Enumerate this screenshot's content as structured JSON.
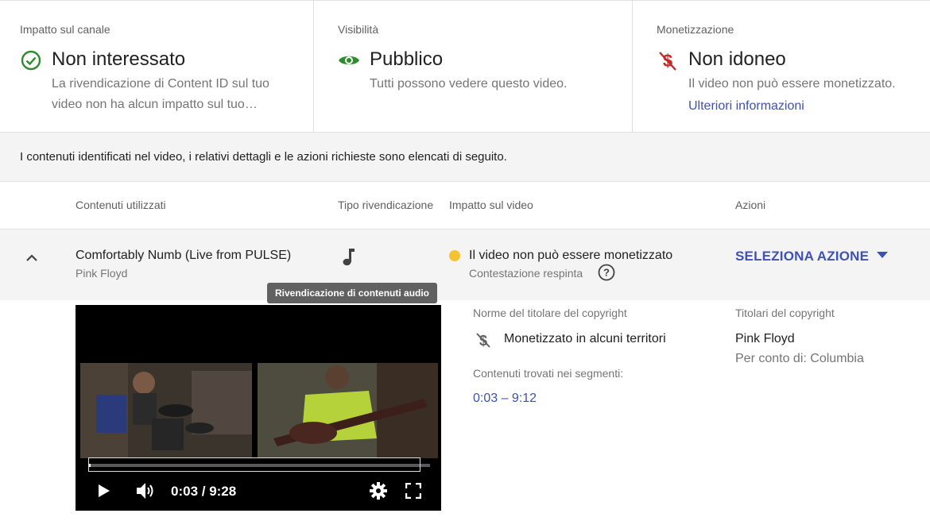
{
  "cards": {
    "channel": {
      "label": "Impatto sul canale",
      "status": "Non interessato",
      "description": "La rivendicazione di Content ID sul tuo video non ha alcun impatto sul tuo…",
      "icon": "check-circle-icon",
      "color": "#2e8b2e"
    },
    "visibility": {
      "label": "Visibilità",
      "status": "Pubblico",
      "description": "Tutti possono vedere questo video.",
      "icon": "eye-icon",
      "color": "#2e8b2e"
    },
    "monetization": {
      "label": "Monetizzazione",
      "status": "Non idoneo",
      "description": "Il video non può essere monetizzato.",
      "link": "Ulteriori informazioni",
      "icon": "no-money-icon",
      "color": "#c62828"
    }
  },
  "info_text": "I contenuti identificati nel video, i relativi dettagli e le azioni richieste sono elencati di seguito.",
  "table": {
    "headers": [
      "Contenuti utilizzati",
      "Tipo rivendicazione",
      "Impatto sul video",
      "Azioni"
    ],
    "claim": {
      "title": "Comfortably Numb (Live from PULSE)",
      "artist": "Pink Floyd",
      "type_icon": "music-note-icon",
      "impact": "Il video non può essere monetizzato",
      "dispute": "Contestazione respinta",
      "action": "SELEZIONA AZIONE",
      "tooltip": "Rivendicazione di contenuti audio"
    }
  },
  "player": {
    "time": "0:03 / 9:28",
    "progress": 0.005
  },
  "details": {
    "policy_label": "Norme del titolare del copyright",
    "policy_value": "Monetizzato in alcuni territori",
    "segments_label": "Contenuti trovati nei segmenti:",
    "segments_value": "0:03 – 9:12",
    "owners_label": "Titolari del copyright",
    "owner": "Pink Floyd",
    "on_behalf": "Per conto di: Columbia"
  },
  "colors": {
    "accent": "#3f51b5",
    "warning_dot": "#f4c430"
  }
}
